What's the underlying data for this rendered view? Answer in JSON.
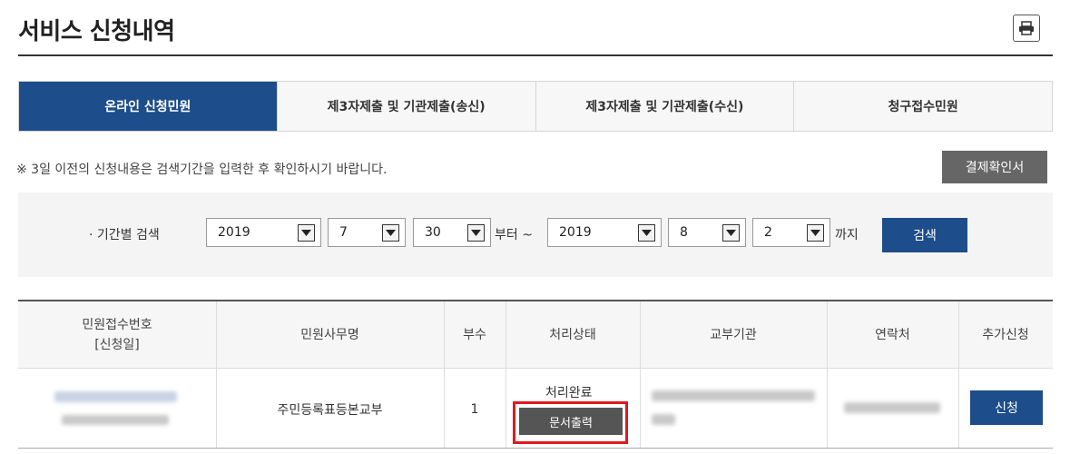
{
  "page": {
    "title": "서비스 신청내역"
  },
  "tabs": [
    {
      "label": "온라인 신청민원",
      "active": true
    },
    {
      "label": "제3자제출 및 기관제출(송신)",
      "active": false
    },
    {
      "label": "제3자제출 및 기관제출(수신)",
      "active": false
    },
    {
      "label": "청구접수민원",
      "active": false
    }
  ],
  "notice": "※ 3일 이전의 신청내용은 검색기간을 입력한 후 확인하시기 바랍니다.",
  "receipt_button": "결제확인서",
  "search": {
    "label": "· 기간별 검색",
    "from": {
      "year": "2019",
      "month": "7",
      "day": "30"
    },
    "from_suffix": "부터 ~",
    "to": {
      "year": "2019",
      "month": "8",
      "day": "2"
    },
    "to_suffix": "까지",
    "button": "검색"
  },
  "table": {
    "headers": {
      "receipt_no_line1": "민원접수번호",
      "receipt_no_line2": "[신청일]",
      "service_name": "민원사무명",
      "copies": "부수",
      "status": "처리상태",
      "issuing_agency": "교부기관",
      "contact": "연락처",
      "additional": "추가신청"
    },
    "rows": [
      {
        "service_name": "주민등록표등본교부",
        "copies": "1",
        "status": "처리완료",
        "print_button": "문서출력",
        "apply_button": "신청"
      }
    ]
  },
  "colors": {
    "primary": "#1d4d8a",
    "highlight": "#e0191e",
    "dark_button": "#555555"
  },
  "icons": {
    "print": "printer-icon",
    "dropdown": "chevron-down-icon"
  }
}
